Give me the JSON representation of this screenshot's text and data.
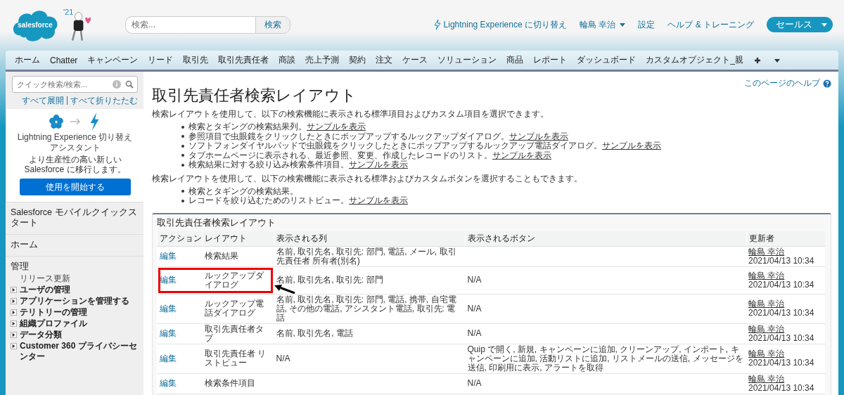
{
  "header": {
    "logo_text": "salesforce",
    "release_badge": "'21",
    "search": {
      "placeholder": "検索...",
      "button": "検索"
    },
    "lightning_link": "Lightning Experience に切り替え",
    "user_menu": "輪島 幸治",
    "setup_link": "設定",
    "help_link": "ヘルプ & トレーニング",
    "app_menu": "セールス"
  },
  "tabs": [
    {
      "label": "ホーム"
    },
    {
      "label": "Chatter"
    },
    {
      "label": "キャンペーン"
    },
    {
      "label": "リード"
    },
    {
      "label": "取引先"
    },
    {
      "label": "取引先責任者"
    },
    {
      "label": "商談"
    },
    {
      "label": "売上予測"
    },
    {
      "label": "契約"
    },
    {
      "label": "注文"
    },
    {
      "label": "ケース"
    },
    {
      "label": "ソリューション"
    },
    {
      "label": "商品"
    },
    {
      "label": "レポート"
    },
    {
      "label": "ダッシュボード"
    },
    {
      "label": "カスタムオブジェクト_親"
    }
  ],
  "sidebar": {
    "search": {
      "placeholder": "クイック検索/検索..."
    },
    "expand_all": "すべて展開",
    "separator": "|",
    "collapse_all": "すべて折りたたむ",
    "assistant": {
      "title": "Lightning Experience 切り替えアシスタント",
      "description": "より生産性の高い新しい Salesforce に移行します。",
      "button": "使用を開始する"
    },
    "sections": [
      {
        "title": "Salesforce モバイルクイックスタート"
      },
      {
        "title": "ホーム"
      },
      {
        "title": "管理",
        "items": [
          {
            "label": "リリース更新",
            "kind": "plain"
          },
          {
            "label": "ユーザの管理",
            "kind": "tree",
            "expanded": false
          },
          {
            "label": "アプリケーションを管理する",
            "kind": "tree",
            "expanded": false
          },
          {
            "label": "テリトリーの管理",
            "kind": "tree",
            "expanded": false
          },
          {
            "label": "組織プロファイル",
            "kind": "tree",
            "expanded": false
          },
          {
            "label": "データ分類",
            "kind": "tree",
            "expanded": false
          },
          {
            "label": "Customer 360 プライバシーセンター",
            "kind": "tree",
            "expanded": false
          }
        ]
      }
    ]
  },
  "page": {
    "help_link": "このページのヘルプ",
    "title": "取引先責任者検索レイアウト",
    "intro_1": "検索レイアウトを使用して、以下の検索機能に表示される標準項目およびカスタム項目を選択できます。",
    "bullets_1": [
      {
        "text": "検索とタギングの検索結果列。",
        "link": "サンプルを表示"
      },
      {
        "text": "参照項目で虫眼鏡をクリックしたときにポップアップするルックアップダイアログ。",
        "link": "サンプルを表示"
      },
      {
        "text": "ソフトフォンダイヤルパッドで虫眼鏡をクリックしたときにポップアップするルックアップ電話ダイアログ。",
        "link": "サンプルを表示"
      },
      {
        "text": "タブホームページに表示される、最近参照、変更、作成したレコードのリスト。",
        "link": "サンプルを表示"
      },
      {
        "text": "検索結果に対する絞り込み検索条件項目。",
        "link": "サンプルを表示"
      }
    ],
    "intro_2": "検索レイアウトを使用して、以下の検索機能に表示される標準およびカスタムボタンを選択することもできます。",
    "bullets_2": [
      {
        "text": "検索とタギングの検索結果。"
      },
      {
        "text": "レコードを絞り込むためのリストビュー。",
        "link": "サンプルを表示"
      }
    ]
  },
  "table": {
    "title": "取引先責任者検索レイアウト",
    "columns": [
      "アクション",
      "レイアウト",
      "表示される列",
      "表示されるボタン",
      "更新者"
    ],
    "rows": [
      {
        "action": "編集",
        "layout": "検索結果",
        "columns": "名前, 取引先名, 取引先: 部門, 電話, メール, 取引先責任者 所有者(別名)",
        "user": "輪島 幸治",
        "date": "2021/04/13 10:34",
        "highlighted": false
      },
      {
        "action": "編集",
        "layout": "ルックアップダイアログ",
        "columns": "名前, 取引先名, 取引先: 部門",
        "buttons": "N/A",
        "user": "輪島 幸治",
        "date": "2021/04/13 10:34",
        "highlighted": true
      },
      {
        "action": "編集",
        "layout": "ルックアップ電話ダイアログ",
        "columns": "名前, 取引先名, 取引先: 部門, 電話, 携帯, 自宅電話, その他の電話, アシスタント電話, 取引先: 電話",
        "buttons": "N/A",
        "user": "輪島 幸治",
        "date": "2021/04/13 10:34",
        "highlighted": false
      },
      {
        "action": "編集",
        "layout": "取引先責任者タブ",
        "columns": "名前, 取引先名, 電話",
        "buttons": "N/A",
        "user": "輪島 幸治",
        "date": "2021/04/13 10:34",
        "highlighted": false
      },
      {
        "action": "編集",
        "layout": "取引先責任者 リストビュー",
        "columns": "N/A",
        "buttons": "Quip で開く, 新規, キャンペーンに追加, クリーンアップ, インポート, キャンペーンに追加, 活動リストに追加, リストメールの送信, メッセージを送信, 印刷用に表示, アラートを取得",
        "user": "輪島 幸治",
        "date": "2021/04/13 10:34",
        "highlighted": false
      },
      {
        "action": "編集",
        "layout": "検索条件項目",
        "buttons": "N/A",
        "user": "輪島 幸治",
        "date": "2021/04/13 10:34",
        "highlighted": false
      }
    ]
  }
}
